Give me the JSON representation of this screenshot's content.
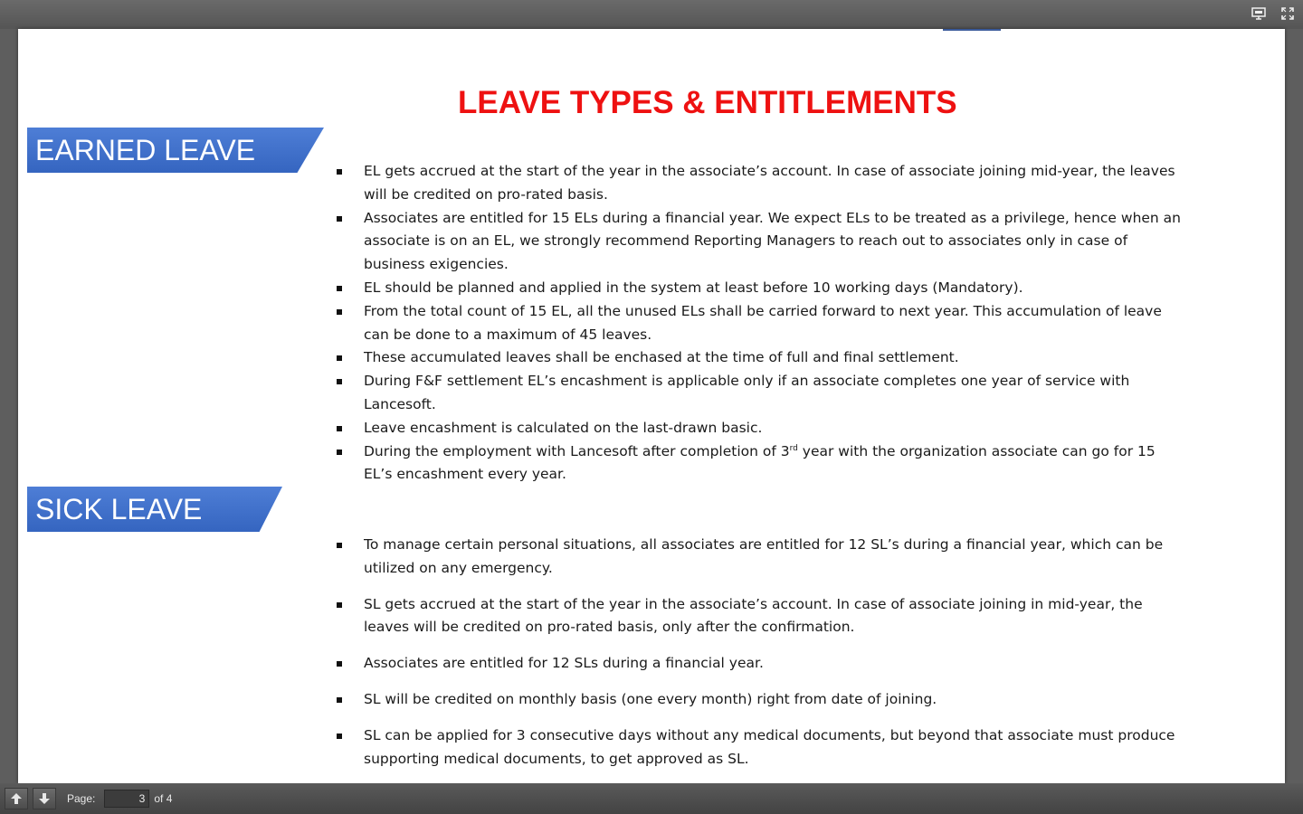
{
  "viewer": {
    "page_label": "Page:",
    "current_page": "3",
    "page_total": "of 4"
  },
  "document": {
    "title": "LEAVE TYPES & ENTITLEMENTS",
    "sections": [
      {
        "heading": "EARNED LEAVE",
        "bullets": [
          "EL gets accrued at the start of the year in the associate’s account. In case of associate joining mid-year, the leaves will be credited on pro-rated basis.",
          "Associates are entitled for 15 ELs during a financial year. We expect ELs to be treated as a privilege, hence when an associate is on an EL, we strongly recommend Reporting Managers to reach out to associates only in case of business exigencies.",
          "EL should be planned and applied in the system at least before 10 working days (Mandatory).",
          "From the total count of 15 EL, all the unused ELs shall be carried forward to next year. This accumulation of leave can be done to a maximum of 45 leaves.",
          "These accumulated leaves shall be enchased at the time of full and final settlement.",
          "During F&F settlement EL’s encashment is applicable only if an associate completes one year of service with Lancesoft.",
          "Leave encashment is calculated on the last-drawn basic.",
          {
            "before": "During the employment with Lancesoft after completion of 3",
            "sup": "rd",
            "after": " year with the organization associate can go for 15 EL’s encashment every year."
          }
        ]
      },
      {
        "heading": "SICK LEAVE",
        "bullets": [
          "To manage certain personal situations, all associates are entitled for 12 SL’s during a financial year, which can be utilized on any emergency.",
          "SL gets accrued at the start of the year in the associate’s account. In case of associate joining in mid-year, the leaves will be credited on pro-rated basis, only after the confirmation.",
          "Associates are entitled for 12 SLs during a financial year.",
          "SL will be credited on monthly basis (one every month) right from date of joining.",
          "SL can be applied for 3 consecutive days without any medical documents, but beyond that associate must produce supporting medical documents, to get approved as SL."
        ]
      }
    ]
  }
}
